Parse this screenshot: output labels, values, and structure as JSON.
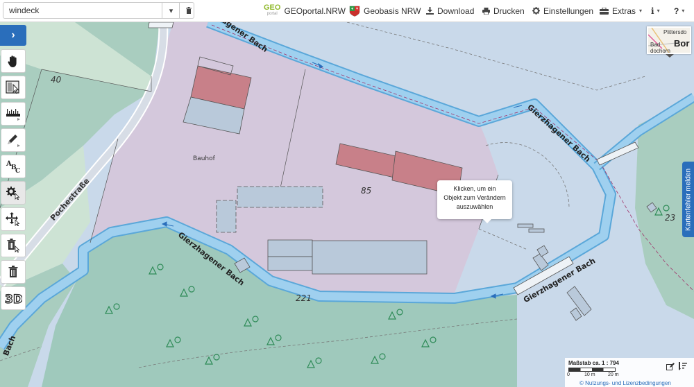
{
  "search": {
    "value": "windeck"
  },
  "nav": {
    "geoportal_logo_top": "GEO",
    "geoportal_logo_bottom": "portal",
    "geoportal": "GEOportal.NRW",
    "geobasis": "Geobasis NRW",
    "download": "Download",
    "drucken": "Drucken",
    "einstellungen": "Einstellungen",
    "extras": "Extras",
    "info": "i",
    "help": "?"
  },
  "popup": {
    "line1": "Klicken, um ein",
    "line2": "Objekt zum Verändern",
    "line3": "auszuwählen"
  },
  "side_tab": "Kartenfehler melden",
  "overview": {
    "label1": "Plittersdo",
    "label2": "Bor",
    "label3": "Bad",
    "label4": "dochorn"
  },
  "scale": {
    "title": "Maßstab ca. 1 : 794",
    "tick0": "0",
    "tick1": "10 m",
    "tick2": "20 m",
    "license": "© Nutzungs- und Lizenzbedingungen"
  },
  "map": {
    "parcel_40": "40",
    "parcel_85": "85",
    "parcel_221": "221",
    "parcel_23": "23",
    "bauhof": "Bauhof",
    "street": "Pochestraße",
    "stream_top": "Gierzhagener Bach",
    "stream_right": "Gierzhagener Bach",
    "stream_bottom": "Gierzhagener Bach",
    "stream_lower_right": "Gierzhagener Bach",
    "stream_left": "Bach"
  }
}
